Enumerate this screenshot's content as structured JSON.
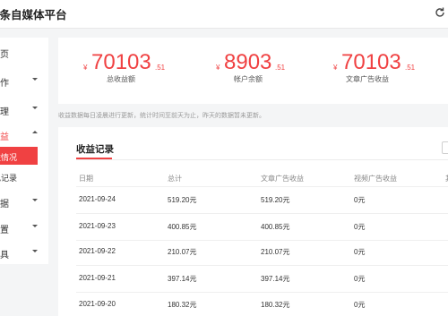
{
  "header": {
    "title": "头条自媒体平台",
    "refresh_icon": "refresh-icon"
  },
  "sidebar": {
    "items": [
      {
        "label": "首页"
      },
      {
        "label": "创作"
      },
      {
        "label": "管理"
      },
      {
        "label": "收益"
      },
      {
        "label": "收益情况"
      },
      {
        "label": "提现记录"
      },
      {
        "label": "数据"
      },
      {
        "label": "设置"
      },
      {
        "label": "工具"
      }
    ]
  },
  "stats": [
    {
      "currency": "¥",
      "integer": "70103",
      "decimal": ".51",
      "caption": "总收益额"
    },
    {
      "currency": "¥",
      "integer": "8903",
      "decimal": ".51",
      "caption": "帐户余额"
    },
    {
      "currency": "¥",
      "integer": "70103",
      "decimal": ".51",
      "caption": "文章广告收益"
    }
  ],
  "note": "收益数据每日凌晨进行更新，统计时间至前天为止，昨天的数据暂未更新。",
  "records": {
    "title": "收益记录",
    "columns": [
      "日期",
      "总计",
      "文章广告收益",
      "视频广告收益",
      "其他"
    ],
    "rows": [
      {
        "date": "2021-09-24",
        "total": "519.20元",
        "article": "519.20元",
        "video": "0元"
      },
      {
        "date": "2021-09-23",
        "total": "400.85元",
        "article": "400.85元",
        "video": "0元"
      },
      {
        "date": "2021-09-22",
        "total": "210.07元",
        "article": "210.07元",
        "video": "0元"
      },
      {
        "date": "2021-09-21",
        "total": "397.14元",
        "article": "397.14元",
        "video": "0元"
      },
      {
        "date": "2021-09-20",
        "total": "180.32元",
        "article": "180.32元",
        "video": "0元"
      }
    ]
  },
  "colors": {
    "accent": "#f04142",
    "background": "#f4f5f6"
  }
}
